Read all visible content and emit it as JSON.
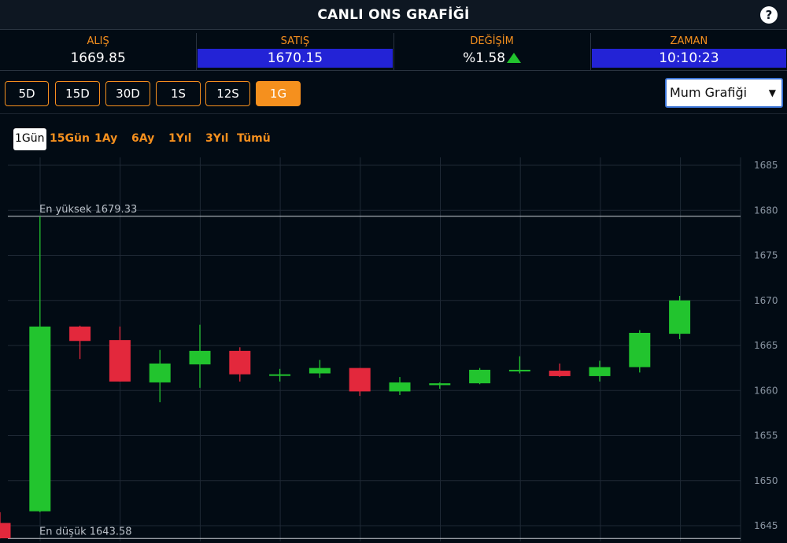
{
  "header": {
    "title": "CANLI ONS GRAFİĞİ",
    "help_label": "?"
  },
  "stats": {
    "bid": {
      "label": "ALIŞ",
      "value": "1669.85"
    },
    "ask": {
      "label": "SATIŞ",
      "value": "1670.15"
    },
    "change": {
      "label": "DEĞİŞİM",
      "value": "%1.58",
      "direction": "up"
    },
    "time": {
      "label": "ZAMAN",
      "value": "10:10:23"
    }
  },
  "periods": [
    "5D",
    "15D",
    "30D",
    "1S",
    "12S",
    "1G"
  ],
  "active_period": "1G",
  "chart_type_select": {
    "value": "Mum Grafiği",
    "arrow": "▼"
  },
  "ranges": [
    "1Gün",
    "15Gün",
    "1Ay",
    "6Ay",
    "1Yıl",
    "3Yıl",
    "Tümü"
  ],
  "active_range": "1Gün",
  "colors": {
    "accent": "#f5901e",
    "up": "#22c42e",
    "down": "#e3283c",
    "header_blue": "#2323d6",
    "background": "#020b14"
  },
  "chart_data": {
    "type": "candlestick",
    "y_ticks": [
      1645,
      1650,
      1655,
      1660,
      1665,
      1670,
      1675,
      1680,
      1685
    ],
    "ylim": [
      1643.5,
      1686.5
    ],
    "high_label": "En yüksek 1679.33",
    "low_label": "En düşük 1643.58",
    "high": 1679.33,
    "low": 1643.58,
    "grid": true,
    "candles": [
      {
        "o": 1645.3,
        "h": 1646.5,
        "l": 1643.58,
        "c": 1643.6
      },
      {
        "o": 1646.6,
        "h": 1679.33,
        "l": 1646.5,
        "c": 1667.1
      },
      {
        "o": 1667.1,
        "h": 1667.2,
        "l": 1663.5,
        "c": 1665.5
      },
      {
        "o": 1665.6,
        "h": 1667.1,
        "l": 1661.0,
        "c": 1661.0
      },
      {
        "o": 1660.9,
        "h": 1664.5,
        "l": 1658.7,
        "c": 1663.0
      },
      {
        "o": 1662.9,
        "h": 1667.3,
        "l": 1660.3,
        "c": 1664.4
      },
      {
        "o": 1664.4,
        "h": 1664.8,
        "l": 1661.0,
        "c": 1661.8
      },
      {
        "o": 1661.8,
        "h": 1662.4,
        "l": 1661.0,
        "c": 1661.8
      },
      {
        "o": 1661.9,
        "h": 1663.4,
        "l": 1661.4,
        "c": 1662.5
      },
      {
        "o": 1662.5,
        "h": 1662.5,
        "l": 1659.4,
        "c": 1659.9
      },
      {
        "o": 1659.9,
        "h": 1661.5,
        "l": 1659.5,
        "c": 1660.9
      },
      {
        "o": 1660.6,
        "h": 1660.9,
        "l": 1660.2,
        "c": 1660.8
      },
      {
        "o": 1660.8,
        "h": 1662.5,
        "l": 1660.7,
        "c": 1662.3
      },
      {
        "o": 1662.3,
        "h": 1663.8,
        "l": 1661.9,
        "c": 1662.3
      },
      {
        "o": 1662.2,
        "h": 1663.0,
        "l": 1661.5,
        "c": 1661.6
      },
      {
        "o": 1661.6,
        "h": 1663.3,
        "l": 1661.0,
        "c": 1662.6
      },
      {
        "o": 1662.6,
        "h": 1666.7,
        "l": 1662.0,
        "c": 1666.4
      },
      {
        "o": 1666.3,
        "h": 1670.5,
        "l": 1665.7,
        "c": 1670.0
      }
    ]
  }
}
